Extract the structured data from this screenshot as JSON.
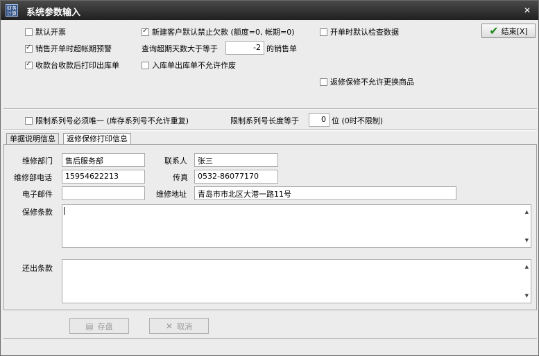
{
  "window": {
    "app_icon_text": "财务\n计算",
    "title": "系统参数输入",
    "close_glyph": "✕"
  },
  "options": {
    "default_invoice": {
      "label": "默认开票",
      "checked": false
    },
    "sales_overdue_warning": {
      "label": "销售开单时超帐期预警",
      "checked": true
    },
    "cashier_print_outbound": {
      "label": "收款台收款后打印出库单",
      "checked": true
    },
    "new_customer_no_credit": {
      "label": "新建客户默认禁止欠款 (额度=0, 帐期=0)",
      "checked": true
    },
    "query_overdue_prefix": "查询超期天数大于等于",
    "query_overdue_days": "-2",
    "query_overdue_suffix": "的销售单",
    "io_no_void": {
      "label": "入库单出库单不允许作废",
      "checked": false
    },
    "default_check_data": {
      "label": "开单时默认检查数据",
      "checked": false
    },
    "repair_return_no_replace": {
      "label": "返修保修不允许更换商品",
      "checked": false
    },
    "serial_unique": {
      "label": "限制系列号必须唯一 (库存系列号不允许重复)",
      "checked": false
    },
    "serial_length_prefix": "限制系列号长度等于",
    "serial_length_value": "0",
    "serial_length_suffix": "位 (0时不限制)"
  },
  "end_button": {
    "label": "结束[X]"
  },
  "tabs": [
    {
      "label": "单据说明信息",
      "active": false
    },
    {
      "label": "返修保修打印信息",
      "active": true
    }
  ],
  "repair_info": {
    "dept_label": "维修部门",
    "dept_value": "售后服务部",
    "contact_label": "联系人",
    "contact_value": "张三",
    "phone_label": "维修部电话",
    "phone_value": "15954622213",
    "fax_label": "传真",
    "fax_value": "0532-86077170",
    "email_label": "电子邮件",
    "email_value": "",
    "address_label": "维修地址",
    "address_value": "青岛市市北区大港一路11号",
    "warranty_label": "保修条款",
    "warranty_value": "",
    "return_label": "还出条款",
    "return_value": ""
  },
  "buttons": {
    "save": {
      "label": "存盘",
      "icon": "save-icon"
    },
    "cancel": {
      "label": "取消",
      "icon": "cancel-x-icon"
    }
  }
}
